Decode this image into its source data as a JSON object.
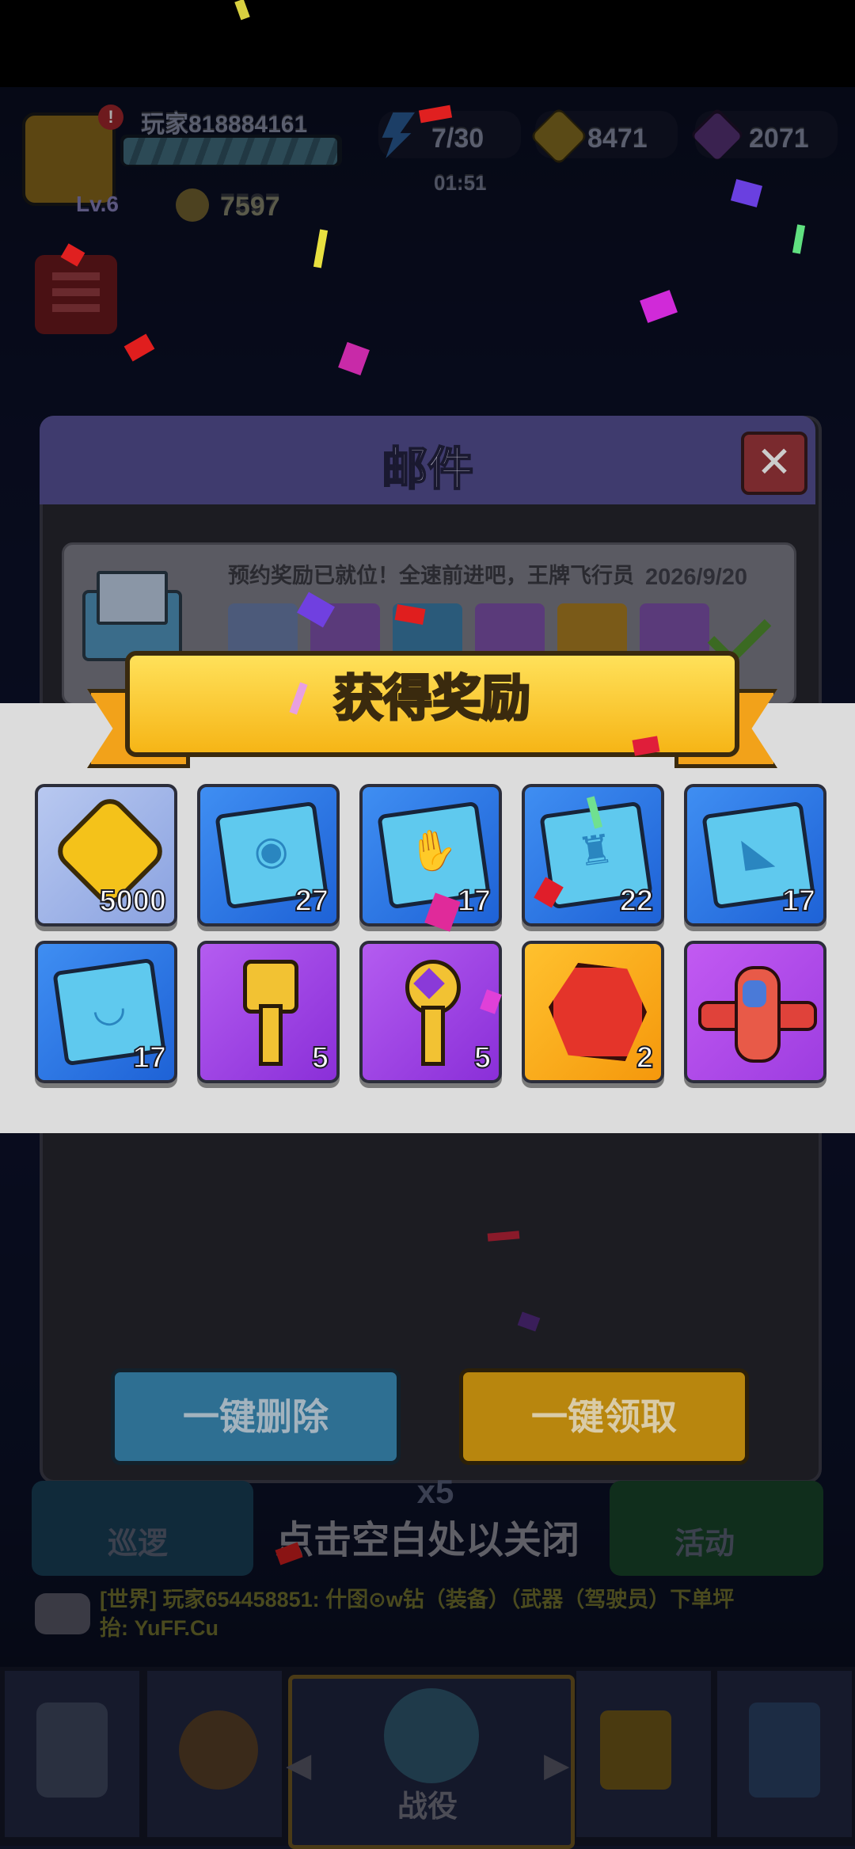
{
  "hud": {
    "player_name": "玩家818884161",
    "level": "Lv.6",
    "power": "7597",
    "energy": "7/30",
    "timer": "01:51",
    "coins": "8471",
    "gems": "2071",
    "badge": "!"
  },
  "mail_panel": {
    "title": "邮件",
    "close_icon": "close-icon",
    "item": {
      "subject": "预约奖励已就位！全速前进吧，王牌飞行员",
      "date": "2026/9/20"
    },
    "delete_all_label": "一键删除",
    "claim_all_label": "一键领取"
  },
  "reward_popup": {
    "title": "获得奖励",
    "items": [
      {
        "name": "coin",
        "icon": "gold-coin-icon",
        "qty": "5000"
      },
      {
        "name": "pilot-helmet-blueprint",
        "icon": "helmet-blueprint-icon",
        "qty": "27"
      },
      {
        "name": "glove-blueprint",
        "icon": "glove-blueprint-icon",
        "qty": "17"
      },
      {
        "name": "jacket-blueprint",
        "icon": "jacket-blueprint-icon",
        "qty": "22"
      },
      {
        "name": "boots-blueprint",
        "icon": "boots-blueprint-icon",
        "qty": "17"
      },
      {
        "name": "necklace-blueprint",
        "icon": "necklace-blueprint-icon",
        "qty": "17"
      },
      {
        "name": "gold-key",
        "icon": "gold-key-icon",
        "qty": "5"
      },
      {
        "name": "purple-key",
        "icon": "purple-key-icon",
        "qty": "5"
      },
      {
        "name": "red-gem",
        "icon": "red-gem-icon",
        "qty": "2"
      },
      {
        "name": "plane",
        "icon": "red-plane-icon",
        "qty": ""
      }
    ],
    "close_hint": "点击空白处以关闭"
  },
  "scene": {
    "multiplier": "x5",
    "left_label": "巡逻",
    "right_label": "活动",
    "chat_line1": "[世界] 玩家654458851: 什囹⊙w钻（装备）（武器（驾驶员）下单坪",
    "chat_line2": "抬: YuFF.Cu",
    "battle_label": "战役"
  },
  "colors": {
    "banner_yellow": "#f6b516",
    "tile_blue": "#1e62d6",
    "tile_purple": "#8a2fd8",
    "mail_header": "#3f3b6e"
  }
}
